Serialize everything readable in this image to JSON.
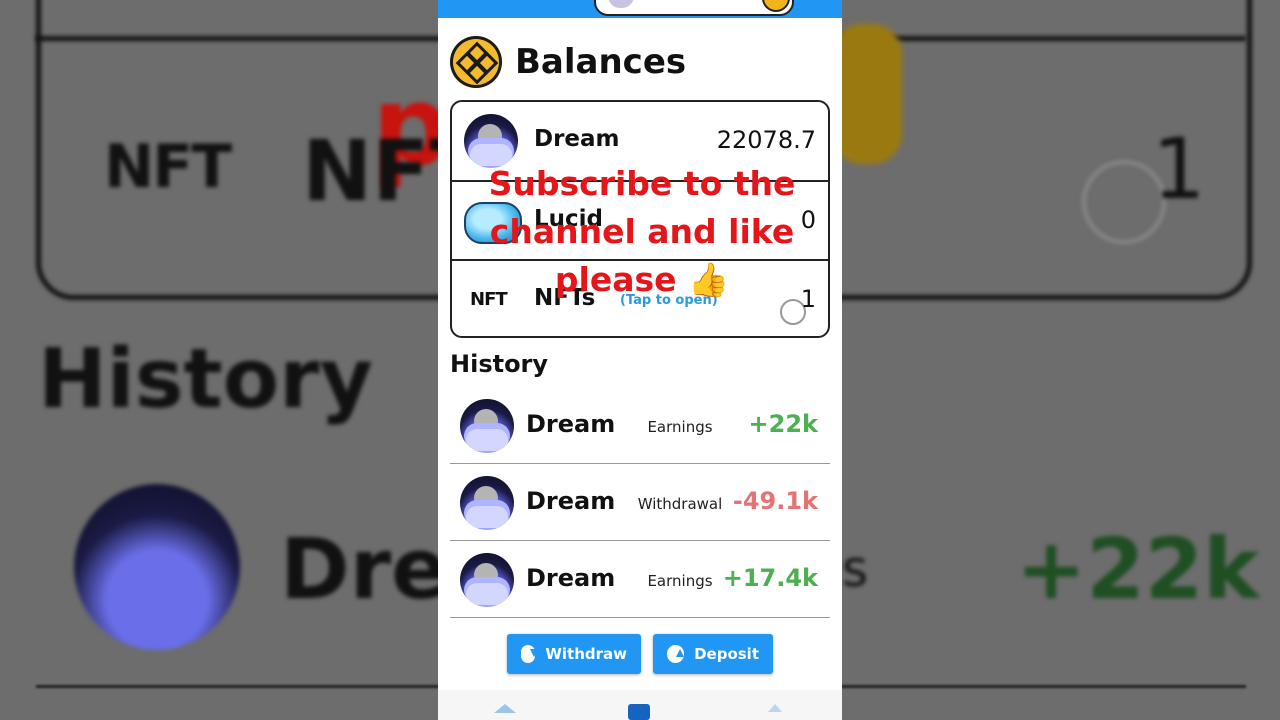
{
  "background": {
    "nft_small": "NFT",
    "nft_big": "NFT",
    "red_letter": "p",
    "one": "1",
    "history": "History",
    "dream": "Drea",
    "s": "s",
    "plus": "+22k"
  },
  "balances": {
    "title": "Balances",
    "icon": "binance-coin-icon",
    "items": [
      {
        "name": "Dream",
        "value": "22078.7",
        "icon": "dream-moon-icon"
      },
      {
        "name": "Lucid",
        "value": "0",
        "icon": "lucid-pillow-icon"
      },
      {
        "name": "NFTs",
        "sub": "(Tap to open)",
        "value": "1",
        "icon": "nft-logo",
        "logo_text": "NFT"
      }
    ]
  },
  "overlay": {
    "text": "Subscribe to the channel and like please 👍"
  },
  "history": {
    "title": "History",
    "rows": [
      {
        "name": "Dream",
        "type": "Earnings",
        "amount": "+22k",
        "sign": "positive"
      },
      {
        "name": "Dream",
        "type": "Withdrawal",
        "amount": "-49.1k",
        "sign": "negative"
      },
      {
        "name": "Dream",
        "type": "Earnings",
        "amount": "+17.4k",
        "sign": "positive"
      }
    ]
  },
  "actions": {
    "withdraw": "Withdraw",
    "deposit": "Deposit"
  },
  "colors": {
    "primary": "#2196f3",
    "positive": "#4caf50",
    "negative": "#e57373",
    "overlay": "#e5151a"
  },
  "nav": [
    "home-icon",
    "wallet-icon",
    "send-icon"
  ]
}
